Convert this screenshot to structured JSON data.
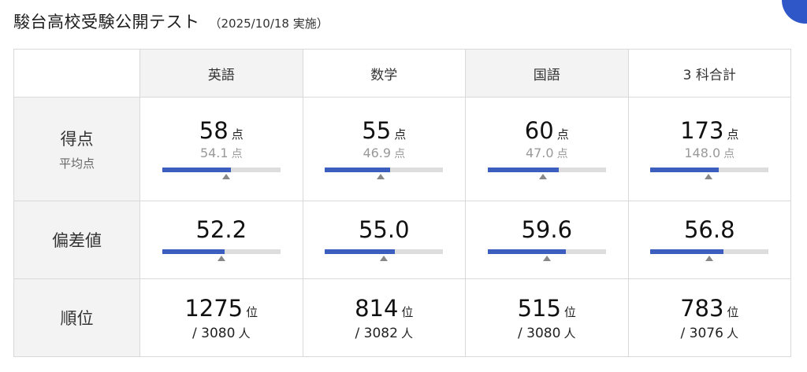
{
  "header": {
    "title": "駿台高校受験公開テスト",
    "date": "（2025/10/18 実施）"
  },
  "columns": [
    "英語",
    "数学",
    "国語",
    "3 科合計"
  ],
  "rows": {
    "score_label": "得点",
    "score_sub": "平均点",
    "deviation_label": "偏差値",
    "rank_label": "順位"
  },
  "units": {
    "point": "点",
    "rank": "位",
    "people": "人"
  },
  "subjects": [
    {
      "score": "58",
      "average": "54.1",
      "score_ratio": 0.58,
      "avg_ratio": 0.541,
      "deviation": "52.2",
      "dev_ratio": 0.53,
      "dev_mark": 0.5,
      "rank": "1275",
      "total": "/ 3080"
    },
    {
      "score": "55",
      "average": "46.9",
      "score_ratio": 0.55,
      "avg_ratio": 0.469,
      "deviation": "55.0",
      "dev_ratio": 0.59,
      "dev_mark": 0.5,
      "rank": "814",
      "total": "/ 3082"
    },
    {
      "score": "60",
      "average": "47.0",
      "score_ratio": 0.6,
      "avg_ratio": 0.47,
      "deviation": "59.6",
      "dev_ratio": 0.66,
      "dev_mark": 0.5,
      "rank": "515",
      "total": "/ 3080"
    },
    {
      "score": "173",
      "average": "148.0",
      "score_ratio": 0.577,
      "avg_ratio": 0.493,
      "deviation": "56.8",
      "dev_ratio": 0.62,
      "dev_mark": 0.5,
      "rank": "783",
      "total": "/ 3076"
    }
  ],
  "colors": {
    "bar_fill": "#3c5fbf",
    "bar_track": "#dddddd",
    "marker": "#888888",
    "header_bg": "#f3f3f3",
    "accent": "#2f57c8"
  }
}
